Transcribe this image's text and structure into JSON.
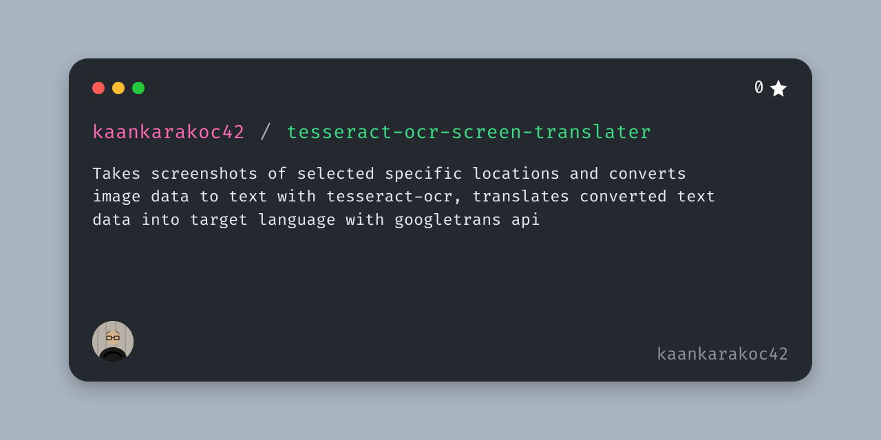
{
  "owner": "kaankarakoc42",
  "separator": "/",
  "repo": "tesseract-ocr-screen-translater",
  "description": "Takes screenshots of selected specific locations and converts image data to text with tesseract-ocr, translates converted text data into target language with googletrans api",
  "stars": "0",
  "footer_owner": "kaankarakoc42",
  "traffic_light_colors": {
    "red": "#ff5c57",
    "yellow": "#ffbd2e",
    "green": "#27c93f"
  }
}
